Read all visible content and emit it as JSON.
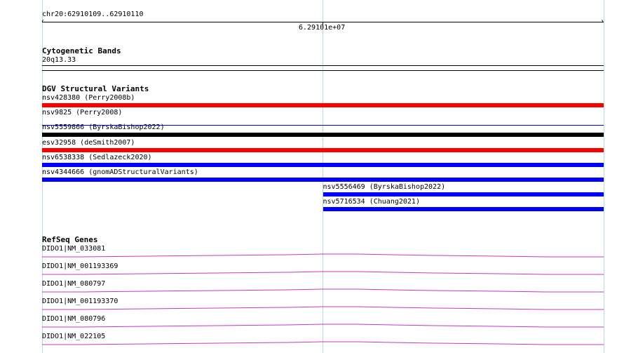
{
  "ruler": {
    "locus": "chr20:62910109..62910110",
    "center_tick": "6.29101e+07"
  },
  "tracks": {
    "cytoband": {
      "title": "Cytogenetic Bands",
      "band": "20q13.33"
    },
    "dgv": {
      "title": "DGV Structural Variants",
      "items": [
        {
          "label": "nsv428380 (Perry2008b)",
          "color": "#ff0000",
          "style": "thick",
          "start": 0.0,
          "end": 1.0
        },
        {
          "label": "nsv9825 (Perry2008)",
          "color": "#0000ff",
          "style": "thin",
          "start": 0.0,
          "end": 1.0
        },
        {
          "label": "nsv5559866 (ByrskaBishop2022)",
          "color": "#000000",
          "style": "thick",
          "start": 0.0,
          "end": 1.0
        },
        {
          "label": "esv32958 (deSmith2007)",
          "color": "#ff0000",
          "style": "thick",
          "start": 0.0,
          "end": 1.0
        },
        {
          "label": "nsv6538338 (Sedlazeck2020)",
          "color": "#0000ff",
          "style": "thick",
          "start": 0.0,
          "end": 1.0
        },
        {
          "label": "nsv4344666 (gnomADStructuralVariants)",
          "color": "#0000ff",
          "style": "thick",
          "start": 0.0,
          "end": 1.0
        },
        {
          "label": "nsv5556469 (ByrskaBishop2022)",
          "color": "#0000ff",
          "style": "thick",
          "start": 0.5,
          "end": 1.0
        },
        {
          "label": "nsv5716534 (Chuang2021)",
          "color": "#0000ff",
          "style": "thick",
          "start": 0.5,
          "end": 1.0
        }
      ]
    },
    "refseq": {
      "title": "RefSeq Genes",
      "color": "#cc33cc",
      "items": [
        {
          "label": "DIDO1|NM_033081"
        },
        {
          "label": "DIDO1|NM_001193369"
        },
        {
          "label": "DIDO1|NM_080797"
        },
        {
          "label": "DIDO1|NM_001193370"
        },
        {
          "label": "DIDO1|NM_080796"
        },
        {
          "label": "DIDO1|NM_022105"
        }
      ]
    }
  }
}
